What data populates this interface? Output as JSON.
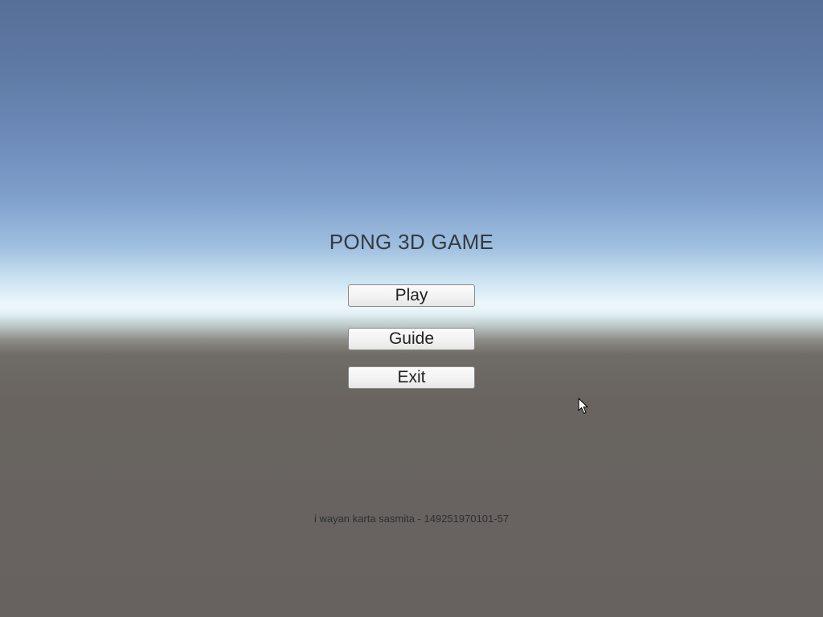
{
  "game": {
    "title": "PONG 3D GAME"
  },
  "menu": {
    "play_label": "Play",
    "guide_label": "Guide",
    "exit_label": "Exit"
  },
  "footer": {
    "credits": "i wayan karta sasmita - 149251970101-57"
  },
  "colors": {
    "sky_top": "#566f98",
    "horizon": "#e9f6fb",
    "ground": "#676260",
    "button_face": "#f1f1f1",
    "title_text": "#333a40"
  },
  "icons": {
    "cursor": "mouse-pointer-icon"
  }
}
